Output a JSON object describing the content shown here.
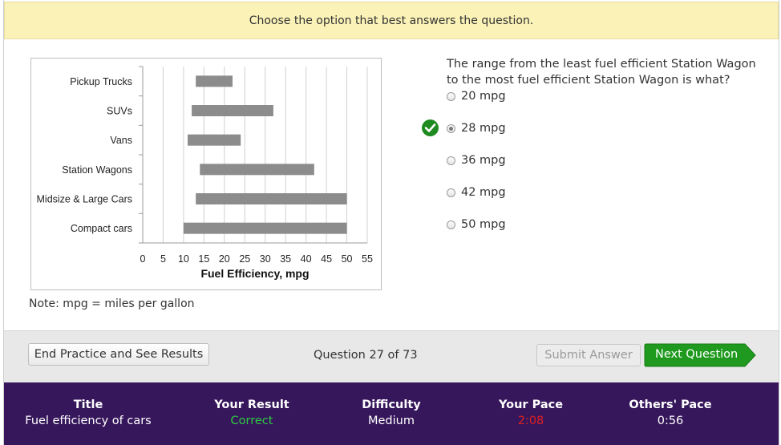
{
  "banner": {
    "text": "Choose the option that best answers the question."
  },
  "chart_data": {
    "type": "bar",
    "orientation": "horizontal-range",
    "categories": [
      "Pickup Trucks",
      "SUVs",
      "Vans",
      "Station Wagons",
      "Midsize & Large Cars",
      "Compact cars"
    ],
    "ranges": [
      [
        13,
        22
      ],
      [
        12,
        32
      ],
      [
        11,
        24
      ],
      [
        14,
        42
      ],
      [
        13,
        50
      ],
      [
        10,
        50
      ]
    ],
    "xlabel": "Fuel Efficiency, mpg",
    "xticks": [
      "0",
      "5",
      "10",
      "15",
      "20",
      "25",
      "30",
      "35",
      "40",
      "45",
      "50",
      "55"
    ],
    "xlim": [
      0,
      55
    ],
    "grid": "vertical",
    "bar_color": "#8c8c8c"
  },
  "note": "Note: mpg = miles per gallon",
  "question": "The range from the least fuel efficient Station Wagon to the most fuel efficient Station Wagon is what?",
  "options": [
    {
      "label": "20 mpg",
      "selected": false
    },
    {
      "label": "28 mpg",
      "selected": true
    },
    {
      "label": "36 mpg",
      "selected": false
    },
    {
      "label": "42 mpg",
      "selected": false
    },
    {
      "label": "50 mpg",
      "selected": false
    }
  ],
  "answer_icon": "check-circle-icon",
  "controls": {
    "end_label": "End Practice and See Results",
    "counter": "Question 27 of 73",
    "submit_label": "Submit Answer",
    "next_label": "Next Question"
  },
  "stats": {
    "title_h": "Title",
    "title_v": "Fuel efficiency of cars",
    "result_h": "Your Result",
    "result_v": "Correct",
    "difficulty_h": "Difficulty",
    "difficulty_v": "Medium",
    "pace_h": "Your Pace",
    "pace_v": "2:08",
    "others_h": "Others' Pace",
    "others_v": "0:56"
  },
  "colors": {
    "banner": "#fbf2b8",
    "next_button": "#1f9a1f",
    "stats_bg": "#36175b",
    "correct": "#2ecc40",
    "pace": "#e02020"
  }
}
